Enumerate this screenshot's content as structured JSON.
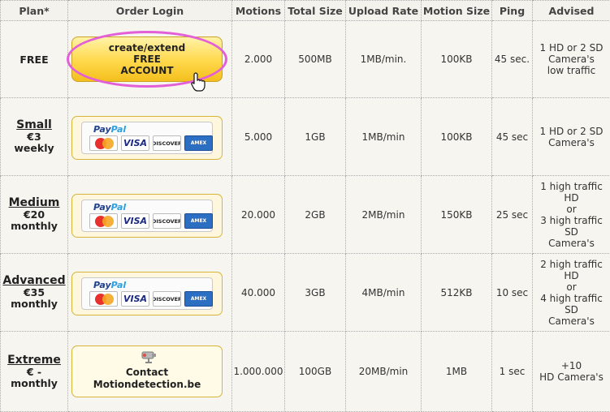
{
  "headers": [
    "Plan*",
    "Order Login",
    "Motions",
    "Total Size",
    "Upload Rate",
    "Motion Size",
    "Ping",
    "Advised"
  ],
  "free_row": {
    "plan": "FREE",
    "button_lines": [
      "create/extend",
      "FREE",
      "ACCOUNT"
    ],
    "motions": "2.000",
    "total_size": "500MB",
    "upload_rate": "1MB/min.",
    "motion_size": "100KB",
    "ping": "45 sec.",
    "advised_lines": [
      "1 HD or 2 SD",
      "Camera's",
      "low traffic"
    ]
  },
  "paid_rows": [
    {
      "plan": "Small",
      "price": "€3",
      "period": "weekly",
      "motions": "5.000",
      "total_size": "1GB",
      "upload_rate": "1MB/min",
      "motion_size": "100KB",
      "ping": "45 sec",
      "advised_lines": [
        "1 HD or 2 SD",
        "Camera's"
      ]
    },
    {
      "plan": "Medium",
      "price": "€20",
      "period": "monthly",
      "motions": "20.000",
      "total_size": "2GB",
      "upload_rate": "2MB/min",
      "motion_size": "150KB",
      "ping": "25 sec",
      "advised_lines": [
        "1 high traffic HD",
        "or",
        "3 high traffic SD",
        "Camera's"
      ]
    },
    {
      "plan": "Advanced",
      "price": "€35",
      "period": "monthly",
      "motions": "40.000",
      "total_size": "3GB",
      "upload_rate": "4MB/min",
      "motion_size": "512KB",
      "ping": "10 sec",
      "advised_lines": [
        "2 high traffic HD",
        "or",
        "4 high traffic SD",
        "Camera's"
      ]
    }
  ],
  "paypal": {
    "logo_part1": "Pay",
    "logo_part2": "Pal",
    "cards": [
      "MasterCard",
      "VISA",
      "DISCOVER",
      "AMEX"
    ]
  },
  "extreme_row": {
    "plan": "Extreme",
    "price": "€ -",
    "period": "monthly",
    "contact_lines": [
      "Contact",
      "Motiondetection.be"
    ],
    "motions": "1.000.000",
    "total_size": "100GB",
    "upload_rate": "20MB/min",
    "motion_size": "1MB",
    "ping": "1 sec",
    "advised_lines": [
      "+10",
      "HD Camera's"
    ]
  },
  "colors": {
    "highlight_ring": "#e35fd8",
    "button_gold": "#ffd84a",
    "paypal_blue": "#1f3f8f"
  }
}
